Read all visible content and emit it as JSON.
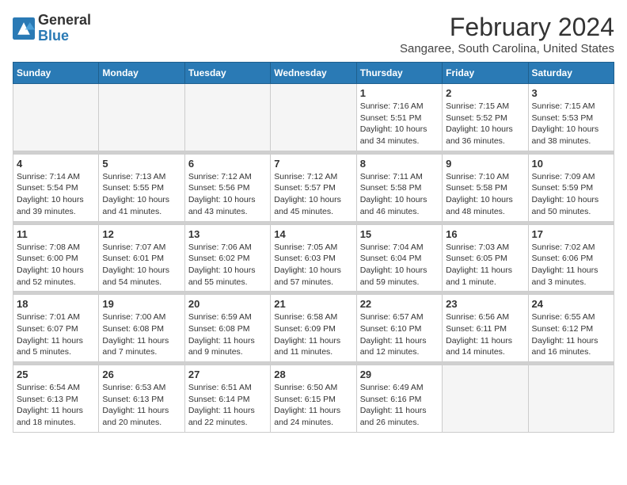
{
  "header": {
    "logo_line1": "General",
    "logo_line2": "Blue",
    "month": "February 2024",
    "location": "Sangaree, South Carolina, United States"
  },
  "weekdays": [
    "Sunday",
    "Monday",
    "Tuesday",
    "Wednesday",
    "Thursday",
    "Friday",
    "Saturday"
  ],
  "weeks": [
    [
      {
        "day": "",
        "info": ""
      },
      {
        "day": "",
        "info": ""
      },
      {
        "day": "",
        "info": ""
      },
      {
        "day": "",
        "info": ""
      },
      {
        "day": "1",
        "info": "Sunrise: 7:16 AM\nSunset: 5:51 PM\nDaylight: 10 hours\nand 34 minutes."
      },
      {
        "day": "2",
        "info": "Sunrise: 7:15 AM\nSunset: 5:52 PM\nDaylight: 10 hours\nand 36 minutes."
      },
      {
        "day": "3",
        "info": "Sunrise: 7:15 AM\nSunset: 5:53 PM\nDaylight: 10 hours\nand 38 minutes."
      }
    ],
    [
      {
        "day": "4",
        "info": "Sunrise: 7:14 AM\nSunset: 5:54 PM\nDaylight: 10 hours\nand 39 minutes."
      },
      {
        "day": "5",
        "info": "Sunrise: 7:13 AM\nSunset: 5:55 PM\nDaylight: 10 hours\nand 41 minutes."
      },
      {
        "day": "6",
        "info": "Sunrise: 7:12 AM\nSunset: 5:56 PM\nDaylight: 10 hours\nand 43 minutes."
      },
      {
        "day": "7",
        "info": "Sunrise: 7:12 AM\nSunset: 5:57 PM\nDaylight: 10 hours\nand 45 minutes."
      },
      {
        "day": "8",
        "info": "Sunrise: 7:11 AM\nSunset: 5:58 PM\nDaylight: 10 hours\nand 46 minutes."
      },
      {
        "day": "9",
        "info": "Sunrise: 7:10 AM\nSunset: 5:58 PM\nDaylight: 10 hours\nand 48 minutes."
      },
      {
        "day": "10",
        "info": "Sunrise: 7:09 AM\nSunset: 5:59 PM\nDaylight: 10 hours\nand 50 minutes."
      }
    ],
    [
      {
        "day": "11",
        "info": "Sunrise: 7:08 AM\nSunset: 6:00 PM\nDaylight: 10 hours\nand 52 minutes."
      },
      {
        "day": "12",
        "info": "Sunrise: 7:07 AM\nSunset: 6:01 PM\nDaylight: 10 hours\nand 54 minutes."
      },
      {
        "day": "13",
        "info": "Sunrise: 7:06 AM\nSunset: 6:02 PM\nDaylight: 10 hours\nand 55 minutes."
      },
      {
        "day": "14",
        "info": "Sunrise: 7:05 AM\nSunset: 6:03 PM\nDaylight: 10 hours\nand 57 minutes."
      },
      {
        "day": "15",
        "info": "Sunrise: 7:04 AM\nSunset: 6:04 PM\nDaylight: 10 hours\nand 59 minutes."
      },
      {
        "day": "16",
        "info": "Sunrise: 7:03 AM\nSunset: 6:05 PM\nDaylight: 11 hours\nand 1 minute."
      },
      {
        "day": "17",
        "info": "Sunrise: 7:02 AM\nSunset: 6:06 PM\nDaylight: 11 hours\nand 3 minutes."
      }
    ],
    [
      {
        "day": "18",
        "info": "Sunrise: 7:01 AM\nSunset: 6:07 PM\nDaylight: 11 hours\nand 5 minutes."
      },
      {
        "day": "19",
        "info": "Sunrise: 7:00 AM\nSunset: 6:08 PM\nDaylight: 11 hours\nand 7 minutes."
      },
      {
        "day": "20",
        "info": "Sunrise: 6:59 AM\nSunset: 6:08 PM\nDaylight: 11 hours\nand 9 minutes."
      },
      {
        "day": "21",
        "info": "Sunrise: 6:58 AM\nSunset: 6:09 PM\nDaylight: 11 hours\nand 11 minutes."
      },
      {
        "day": "22",
        "info": "Sunrise: 6:57 AM\nSunset: 6:10 PM\nDaylight: 11 hours\nand 12 minutes."
      },
      {
        "day": "23",
        "info": "Sunrise: 6:56 AM\nSunset: 6:11 PM\nDaylight: 11 hours\nand 14 minutes."
      },
      {
        "day": "24",
        "info": "Sunrise: 6:55 AM\nSunset: 6:12 PM\nDaylight: 11 hours\nand 16 minutes."
      }
    ],
    [
      {
        "day": "25",
        "info": "Sunrise: 6:54 AM\nSunset: 6:13 PM\nDaylight: 11 hours\nand 18 minutes."
      },
      {
        "day": "26",
        "info": "Sunrise: 6:53 AM\nSunset: 6:13 PM\nDaylight: 11 hours\nand 20 minutes."
      },
      {
        "day": "27",
        "info": "Sunrise: 6:51 AM\nSunset: 6:14 PM\nDaylight: 11 hours\nand 22 minutes."
      },
      {
        "day": "28",
        "info": "Sunrise: 6:50 AM\nSunset: 6:15 PM\nDaylight: 11 hours\nand 24 minutes."
      },
      {
        "day": "29",
        "info": "Sunrise: 6:49 AM\nSunset: 6:16 PM\nDaylight: 11 hours\nand 26 minutes."
      },
      {
        "day": "",
        "info": ""
      },
      {
        "day": "",
        "info": ""
      }
    ]
  ]
}
